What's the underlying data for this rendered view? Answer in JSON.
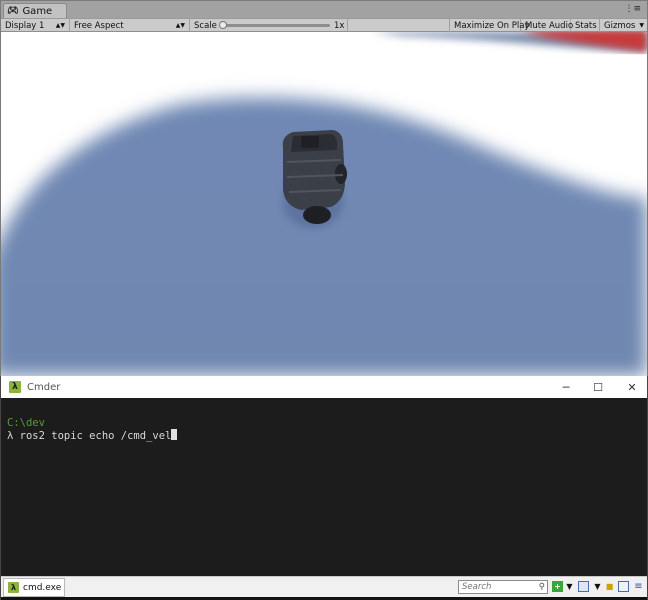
{
  "unity": {
    "tab_title": "Game",
    "toolbar": {
      "display": "Display 1",
      "aspect": "Free Aspect",
      "scale_label": "Scale",
      "scale_value": "1x",
      "maximize_on_play": "Maximize On Play",
      "mute_audio": "Mute Audio",
      "stats": "Stats",
      "gizmos": "Gizmos"
    }
  },
  "cmder": {
    "window_title": "Cmder",
    "controls": {
      "minimize": "─",
      "maximize": "☐",
      "close": "✕"
    },
    "console": {
      "path_line": "C:\\dev",
      "command_line": "λ ros2 topic echo /cmd_vel"
    },
    "status": {
      "tab_label": "cmd.exe",
      "search_placeholder": "Search"
    }
  },
  "colors": {
    "cmder_accent": "#8bb33d",
    "prompt_path": "#5a9a3a",
    "floor_blue": "#6e86b0",
    "unity_panel": "#a2a2a2"
  }
}
